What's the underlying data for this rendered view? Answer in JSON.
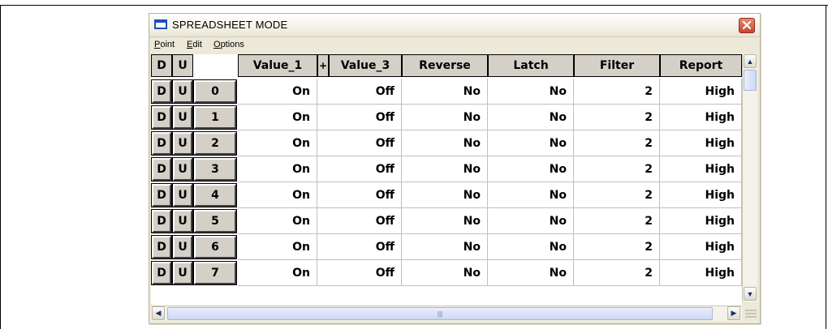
{
  "window": {
    "title": "SPREADSHEET MODE",
    "close_symbol": "×"
  },
  "menu": {
    "items": [
      {
        "label": "Point",
        "mnemonic": "P"
      },
      {
        "label": "Edit",
        "mnemonic": "E"
      },
      {
        "label": "Options",
        "mnemonic": "O"
      }
    ]
  },
  "grid": {
    "header_buttons": [
      "D",
      "U"
    ],
    "columns": [
      "Value_1",
      "+",
      "Value_3",
      "Reverse",
      "Latch",
      "Filter",
      "Report"
    ],
    "rows": [
      {
        "d": "D",
        "u": "U",
        "index": "0",
        "value_1": "On",
        "value_3": "Off",
        "reverse": "No",
        "latch": "No",
        "filter": "2",
        "report": "High"
      },
      {
        "d": "D",
        "u": "U",
        "index": "1",
        "value_1": "On",
        "value_3": "Off",
        "reverse": "No",
        "latch": "No",
        "filter": "2",
        "report": "High"
      },
      {
        "d": "D",
        "u": "U",
        "index": "2",
        "value_1": "On",
        "value_3": "Off",
        "reverse": "No",
        "latch": "No",
        "filter": "2",
        "report": "High"
      },
      {
        "d": "D",
        "u": "U",
        "index": "3",
        "value_1": "On",
        "value_3": "Off",
        "reverse": "No",
        "latch": "No",
        "filter": "2",
        "report": "High"
      },
      {
        "d": "D",
        "u": "U",
        "index": "4",
        "value_1": "On",
        "value_3": "Off",
        "reverse": "No",
        "latch": "No",
        "filter": "2",
        "report": "High"
      },
      {
        "d": "D",
        "u": "U",
        "index": "5",
        "value_1": "On",
        "value_3": "Off",
        "reverse": "No",
        "latch": "No",
        "filter": "2",
        "report": "High"
      },
      {
        "d": "D",
        "u": "U",
        "index": "6",
        "value_1": "On",
        "value_3": "Off",
        "reverse": "No",
        "latch": "No",
        "filter": "2",
        "report": "High"
      },
      {
        "d": "D",
        "u": "U",
        "index": "7",
        "value_1": "On",
        "value_3": "Off",
        "reverse": "No",
        "latch": "No",
        "filter": "2",
        "report": "High"
      }
    ]
  },
  "scrollbars": {
    "up_arrow": "▲",
    "down_arrow": "▼",
    "left_arrow": "◀",
    "right_arrow": "▶",
    "thumb_grip": "|||"
  },
  "colors": {
    "title_icon": "#1d4fb8",
    "close_button": "#c8452b"
  }
}
